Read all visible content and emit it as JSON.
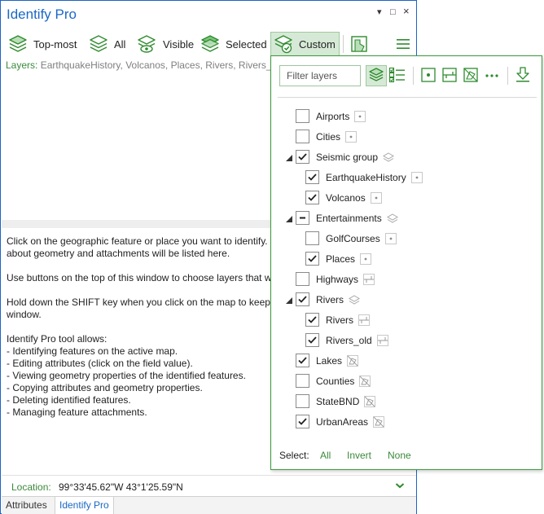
{
  "window": {
    "title": "Identify Pro",
    "controls": [
      "▾",
      "□",
      "×"
    ]
  },
  "toolbar": {
    "buttons": [
      {
        "label": "Top-most"
      },
      {
        "label": "All"
      },
      {
        "label": "Visible"
      },
      {
        "label": "Selected"
      },
      {
        "label": "Custom"
      }
    ]
  },
  "layers_line": {
    "key": "Layers:",
    "value": "EarthquakeHistory, Volcanos, Places, Rivers, Rivers_old"
  },
  "help": {
    "lines": [
      "Click on the geographic feature or place you want to identify. Information",
      "about geometry and attachments will be listed here.",
      "",
      "Use buttons on the top of this window to choose layers that will be",
      "",
      "Hold down the SHIFT key when you click on the map to keep previous results in the",
      "window.",
      "",
      "Identify Pro tool allows:",
      "- Identifying features on the active map.",
      "- Editing attributes (click on the field value).",
      "- Viewing geometry properties of the identified features.",
      "- Copying attributes and geometry properties.",
      "- Deleting identified features.",
      "- Managing feature attachments."
    ]
  },
  "location": {
    "label": "Location:",
    "value": "99°33'45.62\"W 43°1'25.59\"N"
  },
  "tabs": [
    {
      "label": "Attributes"
    },
    {
      "label": "Identify Pro"
    }
  ],
  "popup": {
    "filter_placeholder": "Filter layers",
    "layers": [
      {
        "name": "Airports",
        "state": "unchecked",
        "level": 0,
        "icon": "point-icon"
      },
      {
        "name": "Cities",
        "state": "unchecked",
        "level": 0,
        "icon": "point-icon"
      },
      {
        "name": "Seismic group",
        "state": "checked",
        "level": 0,
        "icon": "group-icon",
        "expandable": true
      },
      {
        "name": "EarthquakeHistory",
        "state": "checked",
        "level": 1,
        "icon": "point-icon"
      },
      {
        "name": "Volcanos",
        "state": "checked",
        "level": 1,
        "icon": "point-icon"
      },
      {
        "name": "Entertainments",
        "state": "mixed",
        "level": 0,
        "icon": "group-icon",
        "expandable": true
      },
      {
        "name": "GolfCourses",
        "state": "unchecked",
        "level": 1,
        "icon": "point-icon"
      },
      {
        "name": "Places",
        "state": "checked",
        "level": 1,
        "icon": "point-icon"
      },
      {
        "name": "Highways",
        "state": "unchecked",
        "level": 0,
        "icon": "line-icon"
      },
      {
        "name": "Rivers",
        "state": "checked",
        "level": 0,
        "icon": "group-icon",
        "expandable": true
      },
      {
        "name": "Rivers",
        "state": "checked",
        "level": 1,
        "icon": "line-icon"
      },
      {
        "name": "Rivers_old",
        "state": "checked",
        "level": 1,
        "icon": "line-icon"
      },
      {
        "name": "Lakes",
        "state": "checked",
        "level": 0,
        "icon": "polygon-icon"
      },
      {
        "name": "Counties",
        "state": "unchecked",
        "level": 0,
        "icon": "polygon-icon"
      },
      {
        "name": "StateBND",
        "state": "unchecked",
        "level": 0,
        "icon": "polygon-icon"
      },
      {
        "name": "UrbanAreas",
        "state": "checked",
        "level": 0,
        "icon": "polygon-icon"
      }
    ],
    "select_label": "Select:",
    "select_links": [
      "All",
      "Invert",
      "None"
    ]
  },
  "colors": {
    "accent_blue": "#1a68c5",
    "accent_green": "#3a8a3a",
    "border_green": "#3a9a3a"
  }
}
